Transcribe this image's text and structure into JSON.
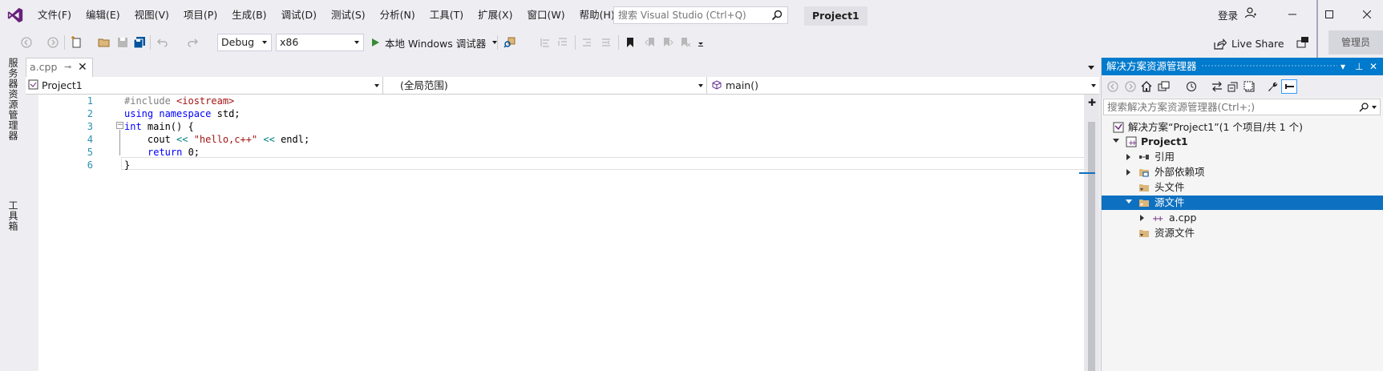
{
  "menubar": {
    "items": [
      "文件(F)",
      "编辑(E)",
      "视图(V)",
      "项目(P)",
      "生成(B)",
      "调试(D)",
      "测试(S)",
      "分析(N)",
      "工具(T)",
      "扩展(X)",
      "窗口(W)",
      "帮助(H)"
    ],
    "search_placeholder": "搜索 Visual Studio (Ctrl+Q)",
    "project_name": "Project1",
    "signin_label": "登录"
  },
  "toolbar": {
    "config": "Debug",
    "platform": "x86",
    "run_label": "本地 Windows 调试器",
    "live_share_label": "Live Share",
    "admin_label": "管理员"
  },
  "side_tabs": {
    "server_explorer": "服务器资源管理器",
    "toolbox": "工具箱"
  },
  "document_tab": {
    "filename": "a.cpp"
  },
  "navbar": {
    "project": "Project1",
    "scope": "(全局范围)",
    "member": "main()"
  },
  "editor": {
    "line_numbers": [
      "1",
      "2",
      "3",
      "4",
      "5",
      "6"
    ],
    "tokens": {
      "l1_directive": "#include ",
      "l1_header": "<iostream>",
      "l2_using": "using",
      "l2_namespace": "namespace",
      "l2_rest": " std;",
      "l3_int": "int",
      "l3_rest": " main() {",
      "l4_cout": "    cout ",
      "l4_op1": "<<",
      "l4_str": " \"hello,c++\" ",
      "l4_op2": "<<",
      "l4_rest": " endl;",
      "l5_return": "return",
      "l5_rest": " 0;",
      "l6_brace": "}"
    }
  },
  "solution_explorer": {
    "title": "解决方案资源管理器",
    "search_placeholder": "搜索解决方案资源管理器(Ctrl+;)",
    "tree": {
      "solution": "解决方案“Project1”(1 个项目/共 1 个)",
      "project": "Project1",
      "references": "引用",
      "external_deps": "外部依赖项",
      "header_files": "头文件",
      "source_files": "源文件",
      "a_cpp": "a.cpp",
      "resource_files": "资源文件"
    }
  },
  "colors": {
    "accent": "#007acc",
    "selection": "#0e70c0",
    "keyword": "#0000ff",
    "string": "#a31515",
    "line_number": "#2b91af"
  }
}
